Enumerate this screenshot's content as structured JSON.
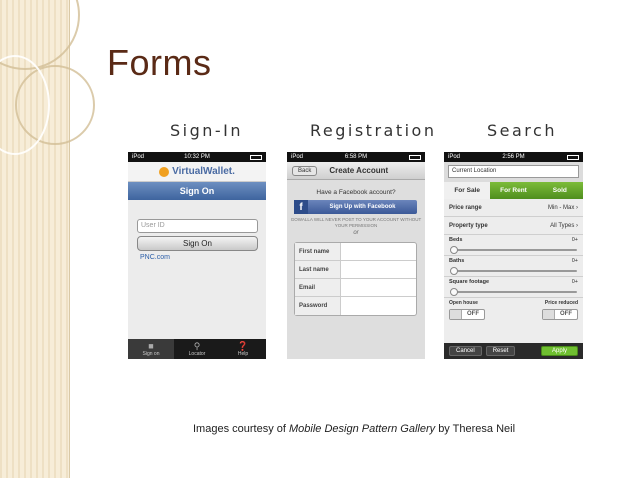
{
  "slide": {
    "title": "Forms",
    "labels": {
      "signin": "Sign-In",
      "registration": "Registration",
      "search": "Search"
    },
    "credit": {
      "prefix": "Images courtesy of",
      "source": "Mobile Design Pattern Gallery",
      "suffix": "by Theresa Neil"
    }
  },
  "signin": {
    "status": {
      "carrier": "iPod",
      "time": "10:32 PM"
    },
    "brand": "VirtualWallet.",
    "nav_title": "Sign On",
    "user_placeholder": "User ID",
    "button": "Sign On",
    "link": "PNC.com",
    "tabs": [
      {
        "label": "Sign on",
        "icon": "lock-icon"
      },
      {
        "label": "Locator",
        "icon": "magnifier-icon"
      },
      {
        "label": "Help",
        "icon": "help-icon"
      }
    ]
  },
  "registration": {
    "status": {
      "carrier": "iPod",
      "time": "6:58 PM"
    },
    "back": "Back",
    "nav_title": "Create Account",
    "question": "Have a Facebook account?",
    "fb_button": "Sign Up with Facebook",
    "note": "GOWALLA WILL NEVER POST TO YOUR ACCOUNT WITHOUT YOUR PERMISSION",
    "or": "or",
    "fields": [
      "First name",
      "Last name",
      "Email",
      "Password"
    ]
  },
  "search": {
    "status": {
      "carrier": "iPod",
      "time": "2:56 PM"
    },
    "location": "Current Location",
    "segments": [
      "For Sale",
      "For Rent",
      "Sold"
    ],
    "rows": [
      {
        "label": "Price range",
        "value": "Min - Max"
      },
      {
        "label": "Property type",
        "value": "All Types"
      }
    ],
    "sliders": [
      {
        "label": "Beds",
        "value": "0+"
      },
      {
        "label": "Baths",
        "value": "0+"
      },
      {
        "label": "Square footage",
        "value": "0+"
      }
    ],
    "toggles": [
      {
        "label": "Open house",
        "value": "OFF"
      },
      {
        "label": "Price reduced",
        "value": "OFF"
      }
    ],
    "buttons": {
      "cancel": "Cancel",
      "reset": "Reset",
      "apply": "Apply"
    }
  }
}
